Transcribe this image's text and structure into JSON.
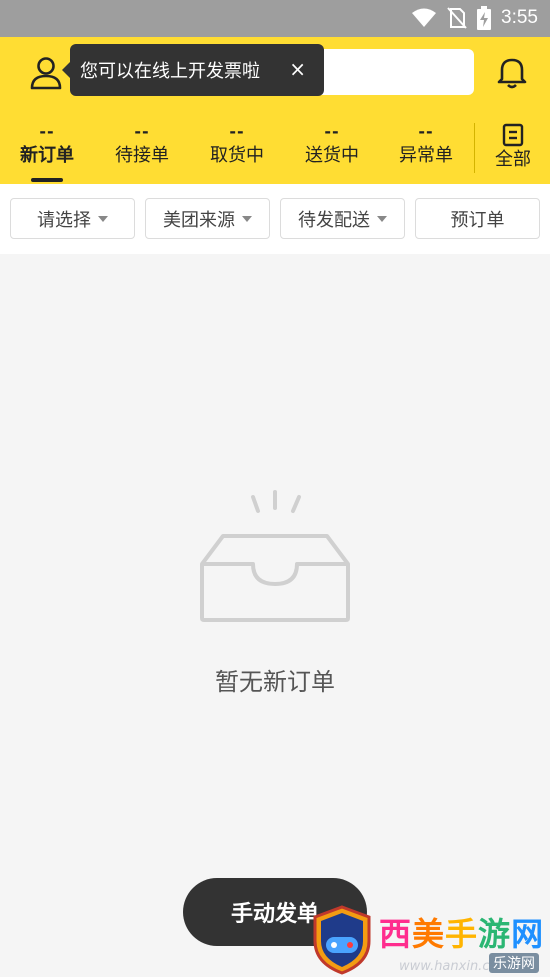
{
  "status_bar": {
    "time": "3:55",
    "icons": [
      "wifi-icon",
      "no-sim-icon",
      "battery-charging-icon"
    ]
  },
  "header": {
    "tooltip": {
      "text": "您可以在线上开发票啦",
      "close_label": "×"
    },
    "tabs": [
      {
        "count": "--",
        "label": "新订单",
        "active": true
      },
      {
        "count": "--",
        "label": "待接单"
      },
      {
        "count": "--",
        "label": "取货中"
      },
      {
        "count": "--",
        "label": "送货中"
      },
      {
        "count": "--",
        "label": "异常单"
      }
    ],
    "all_tab": {
      "label": "全部",
      "icon": "document-list-icon"
    }
  },
  "filters": [
    {
      "label": "请选择",
      "dropdown": true
    },
    {
      "label": "美团来源",
      "dropdown": true
    },
    {
      "label": "待发配送",
      "dropdown": true
    },
    {
      "label": "预订单",
      "dropdown": false
    }
  ],
  "empty_state": {
    "icon": "empty-tray-icon",
    "text": "暂无新订单"
  },
  "manual_order_button": {
    "label": "手动发单"
  },
  "watermark": {
    "title": "西美手游网",
    "sub": "乐游网",
    "url": "www.hanxin.com"
  },
  "colors": {
    "header_bg": "#ffdd33",
    "status_bar_bg": "#9e9e9e",
    "button_bg": "#333333",
    "page_bg": "#f5f5f5"
  }
}
